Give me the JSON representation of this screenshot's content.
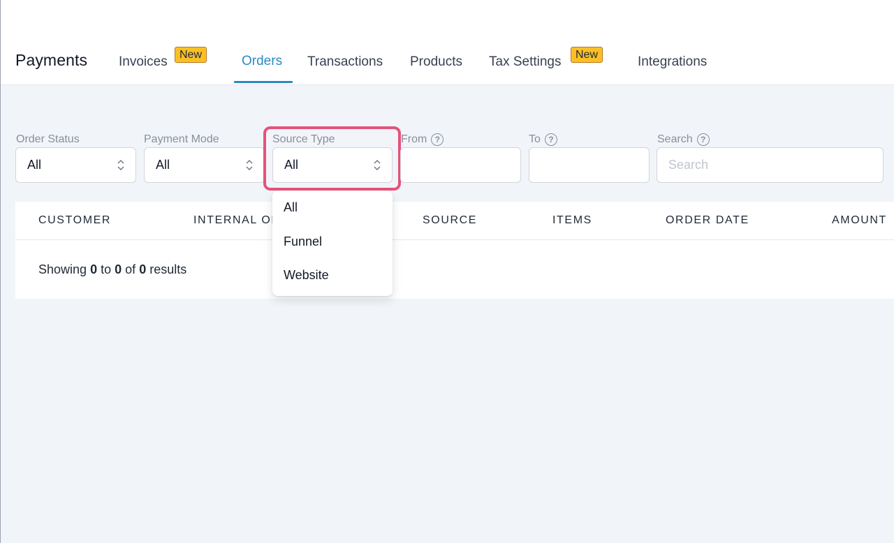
{
  "header": {
    "title": "Payments",
    "tabs": [
      {
        "label": "Invoices",
        "badge": "New"
      },
      {
        "label": "Orders",
        "active": true
      },
      {
        "label": "Transactions"
      },
      {
        "label": "Products"
      },
      {
        "label": "Tax Settings",
        "badge": "New"
      },
      {
        "label": "Integrations"
      }
    ],
    "active_color": "#2b8ac2",
    "badge_color": "#fbbf24"
  },
  "filters": {
    "order_status": {
      "label": "Order Status",
      "value": "All"
    },
    "payment_mode": {
      "label": "Payment Mode",
      "value": "All"
    },
    "source_type": {
      "label": "Source Type",
      "value": "All",
      "highlight_color": "#e4537a"
    },
    "from": {
      "label": "From",
      "value": "",
      "help_icon": "question-circle-icon"
    },
    "to": {
      "label": "To",
      "value": "",
      "help_icon": "question-circle-icon"
    },
    "search": {
      "label": "Search",
      "placeholder": "Search",
      "value": "",
      "help_icon": "question-circle-icon"
    }
  },
  "source_type_options": [
    "All",
    "Funnel",
    "Website"
  ],
  "table": {
    "columns": [
      "CUSTOMER",
      "INTERNAL OR",
      "SOURCE",
      "ITEMS",
      "ORDER DATE",
      "AMOUNT"
    ],
    "showing": {
      "prefix": "Showing",
      "from": "0",
      "to_word": "to",
      "to": "0",
      "of_word": "of",
      "total": "0",
      "suffix": "results"
    }
  }
}
